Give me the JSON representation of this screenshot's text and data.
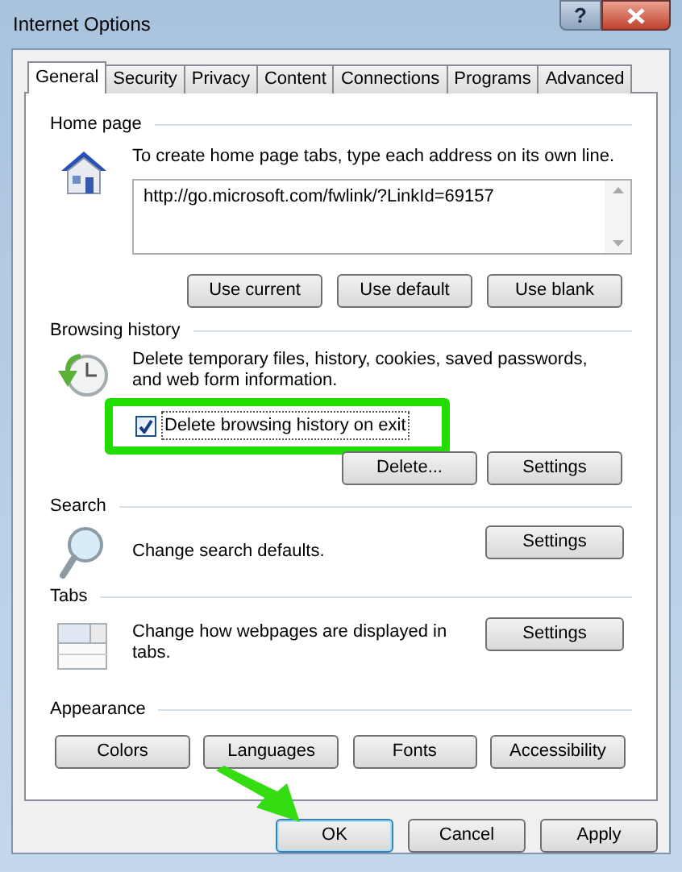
{
  "window": {
    "title": "Internet Options",
    "help_button": "?"
  },
  "tabs": [
    {
      "label": "General",
      "selected": true
    },
    {
      "label": "Security",
      "selected": false
    },
    {
      "label": "Privacy",
      "selected": false
    },
    {
      "label": "Content",
      "selected": false
    },
    {
      "label": "Connections",
      "selected": false
    },
    {
      "label": "Programs",
      "selected": false
    },
    {
      "label": "Advanced",
      "selected": false
    }
  ],
  "home_page": {
    "title": "Home page",
    "description": "To create home page tabs, type each address on its own line.",
    "url": "http://go.microsoft.com/fwlink/?LinkId=69157",
    "buttons": [
      "Use current",
      "Use default",
      "Use blank"
    ]
  },
  "browsing_history": {
    "title": "Browsing history",
    "description": "Delete temporary files, history, cookies, saved passwords, and web form information.",
    "checkbox": {
      "label": "Delete browsing history on exit",
      "checked": true,
      "highlighted": true
    },
    "buttons": [
      "Delete...",
      "Settings"
    ]
  },
  "search": {
    "title": "Search",
    "description": "Change search defaults.",
    "button": "Settings"
  },
  "tabs_section": {
    "title": "Tabs",
    "description": "Change how webpages are displayed in tabs.",
    "button": "Settings"
  },
  "appearance": {
    "title": "Appearance",
    "buttons": [
      "Colors",
      "Languages",
      "Fonts",
      "Accessibility"
    ]
  },
  "dialog_buttons": [
    {
      "label": "OK",
      "default": true,
      "pointed_at": true
    },
    {
      "label": "Cancel",
      "default": false,
      "pointed_at": false
    },
    {
      "label": "Apply",
      "default": false,
      "pointed_at": false
    }
  ]
}
